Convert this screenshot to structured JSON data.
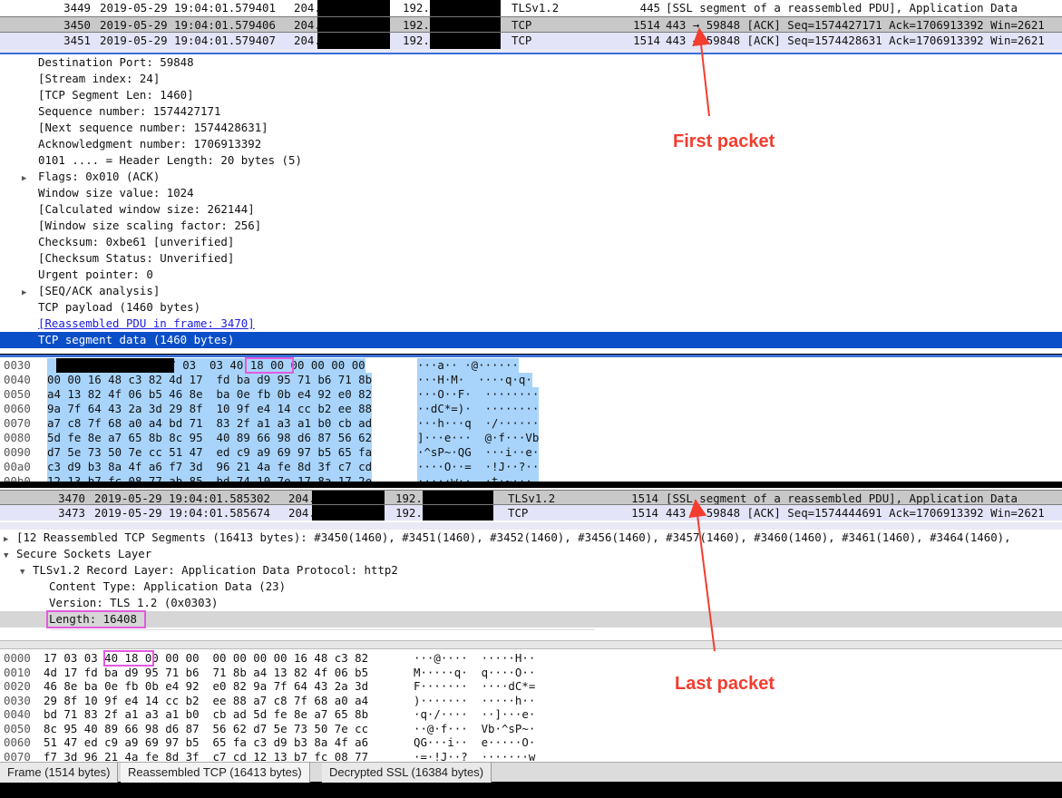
{
  "top_packets": [
    {
      "no": "3449",
      "time": "2019-05-29 19:04:01.579401",
      "src": "204.",
      "dst": "192.",
      "proto": "TLSv1.2",
      "len": "445",
      "info": "[SSL segment of a reassembled PDU], Application Data"
    },
    {
      "no": "3450",
      "time": "2019-05-29 19:04:01.579406",
      "src": "204.",
      "dst": "192.",
      "proto": "TCP",
      "len": "1514",
      "info": "443 → 59848 [ACK] Seq=1574427171 Ack=1706913392 Win=2621"
    },
    {
      "no": "3451",
      "time": "2019-05-29 19:04:01.579407",
      "src": "204.",
      "dst": "192.",
      "proto": "TCP",
      "len": "1514",
      "info": "443 → 59848 [ACK] Seq=1574428631 Ack=1706913392 Win=2621"
    }
  ],
  "top_details": [
    {
      "text": "Destination Port: 59848",
      "link": false,
      "expand": false
    },
    {
      "text": "[Stream index: 24]",
      "link": false,
      "expand": false
    },
    {
      "text": "[TCP Segment Len: 1460]",
      "link": false,
      "expand": false
    },
    {
      "text": "Sequence number: 1574427171",
      "link": false,
      "expand": false
    },
    {
      "text": "[Next sequence number: 1574428631]",
      "link": false,
      "expand": false
    },
    {
      "text": "Acknowledgment number: 1706913392",
      "link": false,
      "expand": false
    },
    {
      "text": "0101 .... = Header Length: 20 bytes (5)",
      "link": false,
      "expand": false
    },
    {
      "text": "Flags: 0x010 (ACK)",
      "link": false,
      "expand": true
    },
    {
      "text": "Window size value: 1024",
      "link": false,
      "expand": false
    },
    {
      "text": "[Calculated window size: 262144]",
      "link": false,
      "expand": false
    },
    {
      "text": "[Window size scaling factor: 256]",
      "link": false,
      "expand": false
    },
    {
      "text": "Checksum: 0xbe61 [unverified]",
      "link": false,
      "expand": false
    },
    {
      "text": "[Checksum Status: Unverified]",
      "link": false,
      "expand": false
    },
    {
      "text": "Urgent pointer: 0",
      "link": false,
      "expand": false
    },
    {
      "text": "[SEQ/ACK analysis]",
      "link": false,
      "expand": true
    },
    {
      "text": "TCP payload (1460 bytes)",
      "link": false,
      "expand": false
    },
    {
      "text": "[Reassembled PDU in frame: 3470]",
      "link": true,
      "expand": false
    },
    {
      "text": "TCP segment data (1460 bytes)",
      "link": false,
      "expand": false,
      "selected": true
    }
  ],
  "top_hex": [
    {
      "off": "0030",
      "hex": "                 17 03  03 40 18 00 00 00 00 00",
      "ascii": "···a·· ·@······"
    },
    {
      "off": "0040",
      "hex": "00 00 16 48 c3 82 4d 17  fd ba d9 95 71 b6 71 8b",
      "ascii": "···H·M·  ····q·q·"
    },
    {
      "off": "0050",
      "hex": "a4 13 82 4f 06 b5 46 8e  ba 0e fb 0b e4 92 e0 82",
      "ascii": "···O··F·  ········"
    },
    {
      "off": "0060",
      "hex": "9a 7f 64 43 2a 3d 29 8f  10 9f e4 14 cc b2 ee 88",
      "ascii": "··dC*=)·  ········"
    },
    {
      "off": "0070",
      "hex": "a7 c8 7f 68 a0 a4 bd 71  83 2f a1 a3 a1 b0 cb ad",
      "ascii": "···h···q  ·/······"
    },
    {
      "off": "0080",
      "hex": "5d fe 8e a7 65 8b 8c 95  40 89 66 98 d6 87 56 62",
      "ascii": "]···e···  @·f···Vb"
    },
    {
      "off": "0090",
      "hex": "d7 5e 73 50 7e cc 51 47  ed c9 a9 69 97 b5 65 fa",
      "ascii": "·^sP~·QG  ···i··e·"
    },
    {
      "off": "00a0",
      "hex": "c3 d9 b3 8a 4f a6 f7 3d  96 21 4a fe 8d 3f c7 cd",
      "ascii": "····O··=  ·!J··?··"
    },
    {
      "off": "00b0",
      "hex": "12 13 b7 fc 08 77 ab 85  bd 74 10 7e 17 8a 17 2e",
      "ascii": "·····w··  ·t·~···."
    }
  ],
  "bottom_packets": [
    {
      "no": "3470",
      "time": "2019-05-29 19:04:01.585302",
      "src": "204.",
      "dst": "192.",
      "proto": "TLSv1.2",
      "len": "1514",
      "info": "[SSL segment of a reassembled PDU], Application Data"
    },
    {
      "no": "3473",
      "time": "2019-05-29 19:04:01.585674",
      "src": "204.",
      "dst": "192.",
      "proto": "TCP",
      "len": "1514",
      "info": "443 → 59848 [ACK] Seq=1574444691 Ack=1706913392 Win=2621"
    }
  ],
  "bottom_details": [
    {
      "text": "[12 Reassembled TCP Segments (16413 bytes): #3450(1460), #3451(1460), #3452(1460), #3456(1460), #3457(1460), #3460(1460), #3461(1460), #3464(1460),",
      "indent": 0,
      "expand": true
    },
    {
      "text": "Secure Sockets Layer",
      "indent": 0,
      "expand": "open"
    },
    {
      "text": "TLSv1.2 Record Layer: Application Data Protocol: http2",
      "indent": 1,
      "expand": "open"
    },
    {
      "text": "Content Type: Application Data (23)",
      "indent": 2,
      "expand": false
    },
    {
      "text": "Version: TLS 1.2 (0x0303)",
      "indent": 2,
      "expand": false
    },
    {
      "text": "Length: 16408",
      "indent": 2,
      "expand": false,
      "highlight": true
    }
  ],
  "bottom_hex": [
    {
      "off": "0000",
      "hex": "17 03 03 40 18 00 00 00  00 00 00 00 16 48 c3 82",
      "ascii": "···@····  ·····H··"
    },
    {
      "off": "0010",
      "hex": "4d 17 fd ba d9 95 71 b6  71 8b a4 13 82 4f 06 b5",
      "ascii": "M·····q·  q····O··"
    },
    {
      "off": "0020",
      "hex": "46 8e ba 0e fb 0b e4 92  e0 82 9a 7f 64 43 2a 3d",
      "ascii": "F·······  ····dC*="
    },
    {
      "off": "0030",
      "hex": "29 8f 10 9f e4 14 cc b2  ee 88 a7 c8 7f 68 a0 a4",
      "ascii": ")·······  ·····h··"
    },
    {
      "off": "0040",
      "hex": "bd 71 83 2f a1 a3 a1 b0  cb ad 5d fe 8e a7 65 8b",
      "ascii": "·q·/····  ··]···e·"
    },
    {
      "off": "0050",
      "hex": "8c 95 40 89 66 98 d6 87  56 62 d7 5e 73 50 7e cc",
      "ascii": "··@·f···  Vb·^sP~·"
    },
    {
      "off": "0060",
      "hex": "51 47 ed c9 a9 69 97 b5  65 fa c3 d9 b3 8a 4f a6",
      "ascii": "QG···i··  e·····O·"
    },
    {
      "off": "0070",
      "hex": "f7 3d 96 21 4a fe 8d 3f  c7 cd 12 13 b7 fc 08 77",
      "ascii": "·=·!J··?  ·······w"
    }
  ],
  "tabs": [
    "Frame (1514 bytes)",
    "Reassembled TCP (16413 bytes)",
    "Decrypted SSL (16384 bytes)"
  ],
  "annotations": {
    "first": "First packet",
    "last": "Last packet"
  },
  "colors": {
    "accent_red": "#f23d2f",
    "highlight_pink": "#e25ae0",
    "selection_blue": "#0a4ec8"
  }
}
